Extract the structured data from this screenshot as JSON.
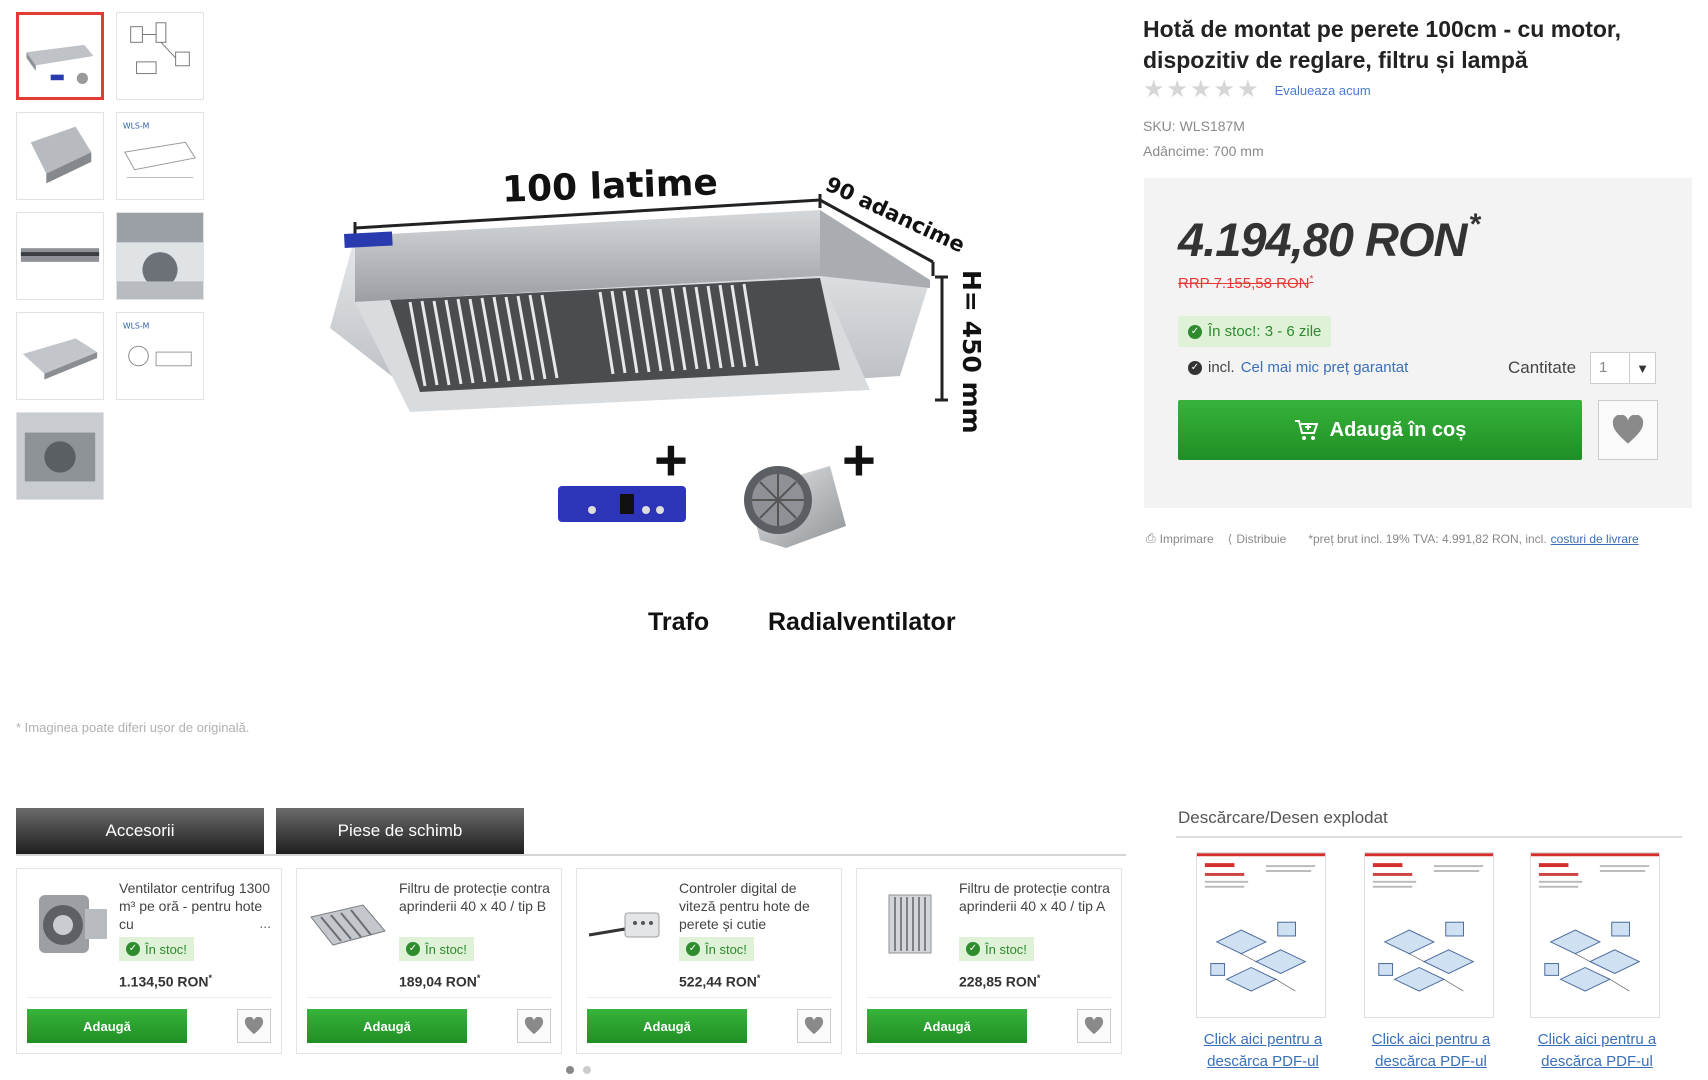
{
  "product": {
    "title": "Hotă de montat pe perete 100cm - cu motor, dispozitiv de reglare, filtru și lampă",
    "rate_link": "Evalueaza acum",
    "sku": "SKU: WLS187M",
    "depth": "Adâncime: 700 mm",
    "rating_stars": 5
  },
  "image": {
    "dim_width": "100 latime",
    "dim_depth": "90 adancime",
    "dim_height": "H= 450 mm",
    "accessory_1": "Trafo",
    "accessory_2": "Radialventilator",
    "note": "* Imaginea poate diferi ușor de originală."
  },
  "buybox": {
    "price": "4.194,80 RON",
    "price_mark": "*",
    "rrp": "RRP 7.155,58 RON",
    "rrp_mark": "*",
    "stock": "În stoc!: 3 - 6 zile",
    "guarantee_prefix": "incl.",
    "guarantee_link": "Cel mai mic preț garantat",
    "qty_label": "Cantitate",
    "qty_value": "1",
    "add_to_cart": "Adaugă în coș"
  },
  "tools": {
    "print": "Imprimare",
    "share": "Distribuie",
    "vat_note": "*preț brut incl. 19% TVA: 4.991,82 RON, incl.",
    "shipping_link": "costuri de livrare"
  },
  "tabs": [
    {
      "label": "Accesorii"
    },
    {
      "label": "Piese de schimb"
    }
  ],
  "accessories": [
    {
      "name": "Ventilator centrifug 1300 m³ pe oră - pentru hote cu",
      "more": "...",
      "stock": "În stoc!",
      "price": "1.134,50 RON",
      "add": "Adaugă"
    },
    {
      "name": "Filtru de protecție contra aprinderii 40 x 40 / tip B",
      "more": "",
      "stock": "În stoc!",
      "price": "189,04 RON",
      "add": "Adaugă"
    },
    {
      "name": "Controler digital de viteză pentru hote de perete și cutie",
      "more": "",
      "stock": "În stoc!",
      "price": "522,44 RON",
      "add": "Adaugă"
    },
    {
      "name": "Filtru de protecție contra aprinderii 40 x 40 / tip A",
      "more": "",
      "stock": "În stoc!",
      "price": "228,85 RON",
      "add": "Adaugă"
    }
  ],
  "downloads": {
    "title": "Descărcare/Desen explodat",
    "items": [
      {
        "link": "Click aici pentru a descărca PDF-ul"
      },
      {
        "link": "Click aici pentru a descărca PDF-ul"
      },
      {
        "link": "Click aici pentru a descărca PDF-ul"
      }
    ]
  },
  "colors": {
    "accent_green": "#2b9f2f",
    "price_red": "#e53935",
    "link_blue": "#3a6fb8"
  }
}
